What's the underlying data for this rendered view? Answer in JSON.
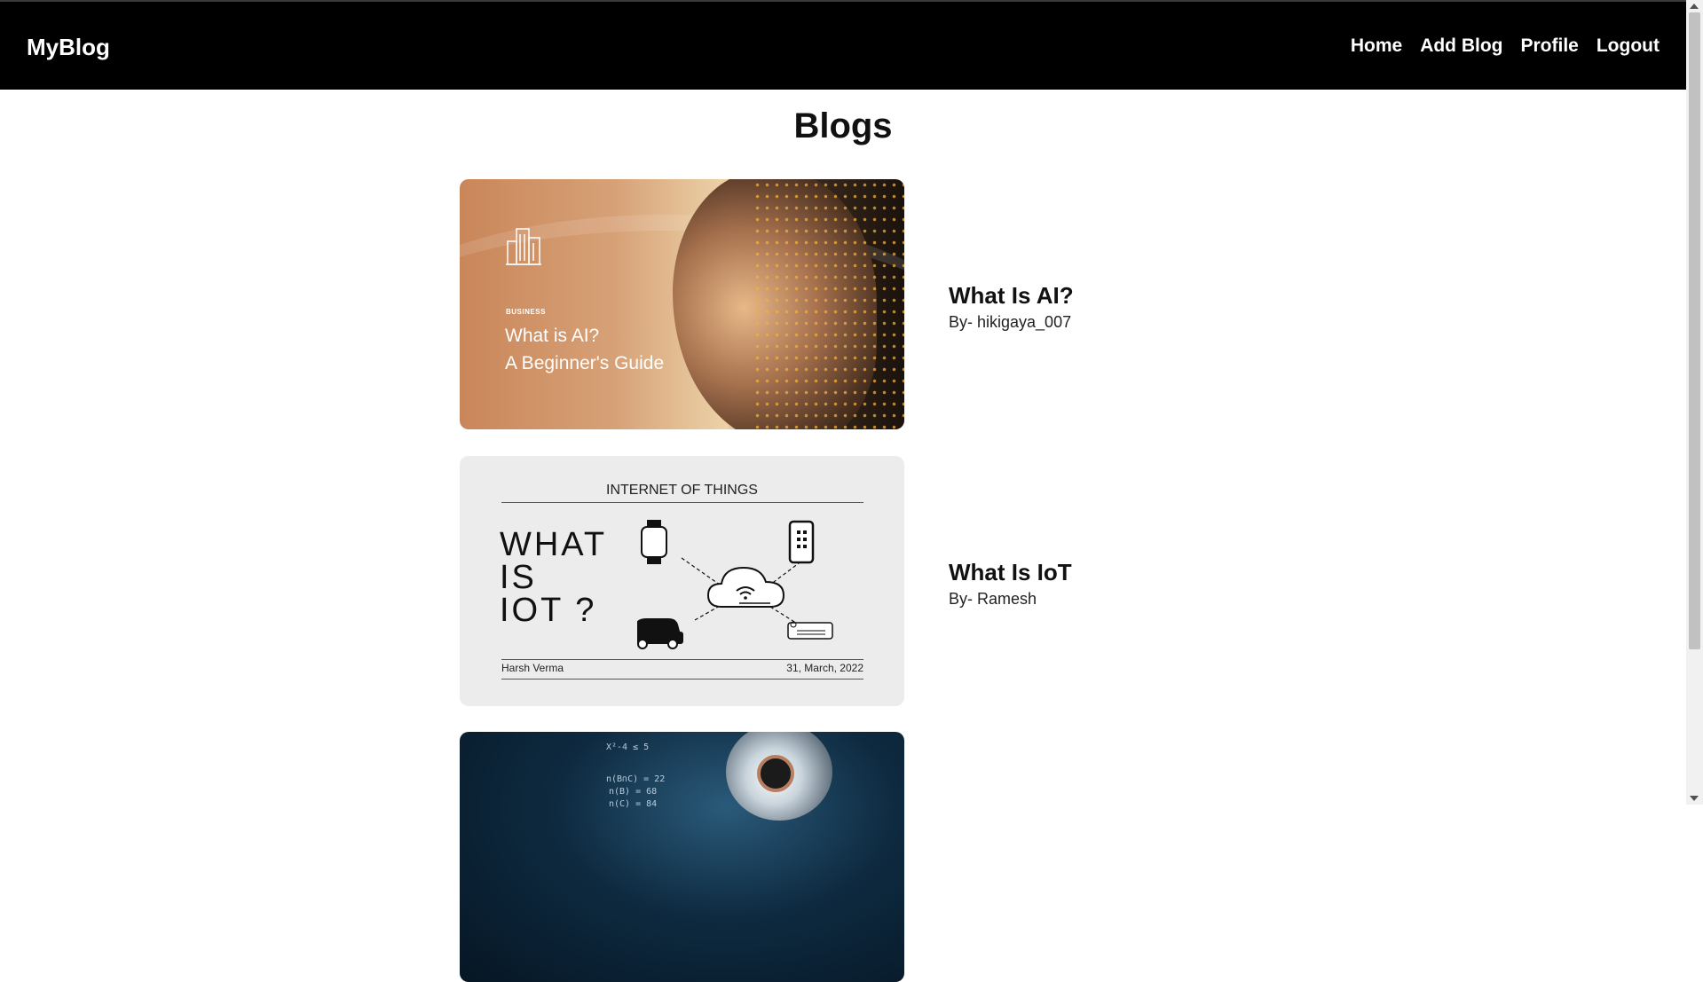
{
  "navbar": {
    "brand": "MyBlog",
    "links": [
      "Home",
      "Add Blog",
      "Profile",
      "Logout"
    ]
  },
  "page": {
    "title": "Blogs"
  },
  "blogs": [
    {
      "title": "What Is AI?",
      "author": "By- hikigaya_007",
      "image": {
        "kicker": "BUSINESS",
        "headline_line1": "What is AI?",
        "headline_line2": "A Beginner's Guide"
      }
    },
    {
      "title": "What Is IoT",
      "author": "By- Ramesh",
      "image": {
        "kicker": "INTERNET OF THINGS",
        "big_line1": "WHAT",
        "big_line2": "IS",
        "big_line3": "IOT ?",
        "byline": "Harsh Verma",
        "date": "31, March, 2022"
      }
    },
    {
      "title": "",
      "author": "",
      "image": {
        "formula_1": "X²-4 ≤ 5",
        "formula_2": "n(B∩C) = 22",
        "formula_3": "n(B) = 68",
        "formula_4": "n(C) = 84"
      }
    }
  ],
  "colors": {
    "navbar_bg": "#000000",
    "page_bg": "#ffffff",
    "text": "#111111"
  }
}
